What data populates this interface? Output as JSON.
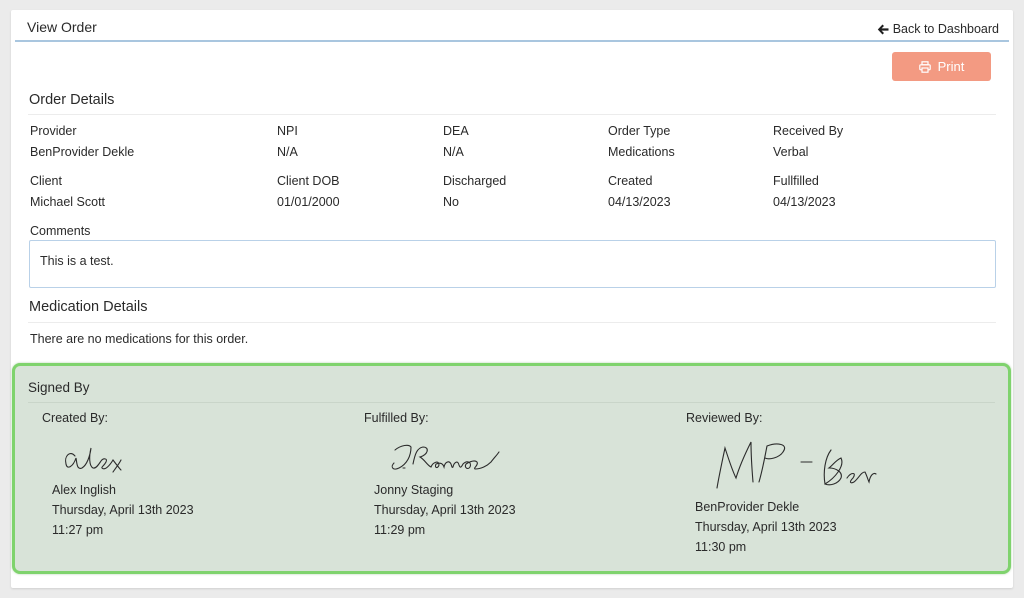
{
  "header": {
    "title": "View Order",
    "back_label": "Back to Dashboard"
  },
  "toolbar": {
    "print_label": "Print"
  },
  "order_details": {
    "title": "Order Details",
    "provider_label": "Provider",
    "provider_value": "BenProvider Dekle",
    "npi_label": "NPI",
    "npi_value": "N/A",
    "dea_label": "DEA",
    "dea_value": "N/A",
    "order_type_label": "Order Type",
    "order_type_value": "Medications",
    "received_by_label": "Received By",
    "received_by_value": "Verbal",
    "client_label": "Client",
    "client_value": "Michael Scott",
    "client_dob_label": "Client DOB",
    "client_dob_value": "01/01/2000",
    "discharged_label": "Discharged",
    "discharged_value": "No",
    "created_label": "Created",
    "created_value": "04/13/2023",
    "fulfilled_label": "Fullfilled",
    "fulfilled_value": "04/13/2023",
    "comments_label": "Comments",
    "comments_value": "This is a test."
  },
  "medication_details": {
    "title": "Medication Details",
    "empty_message": "There are no medications for this order."
  },
  "signed_by": {
    "title": "Signed By",
    "signatures": [
      {
        "label": "Created By:",
        "signature_text": "alex",
        "name": "Alex Inglish",
        "date": "Thursday, April 13th 2023",
        "time": "11:27 pm"
      },
      {
        "label": "Fulfilled By:",
        "signature_text": "J.Ramos",
        "name": "Jonny Staging",
        "date": "Thursday, April 13th 2023",
        "time": "11:29 pm"
      },
      {
        "label": "Reviewed By:",
        "signature_text": "MP-Ben",
        "name": "BenProvider Dekle",
        "date": "Thursday, April 13th 2023",
        "time": "11:30 pm"
      }
    ]
  },
  "colors": {
    "print_button": "#f39a82",
    "header_rule": "#a9c6df",
    "signed_panel_bg": "#d8e3d8",
    "signed_panel_border": "#7fd36d"
  },
  "icons": {
    "back": "arrow-left-icon",
    "print": "printer-icon"
  }
}
